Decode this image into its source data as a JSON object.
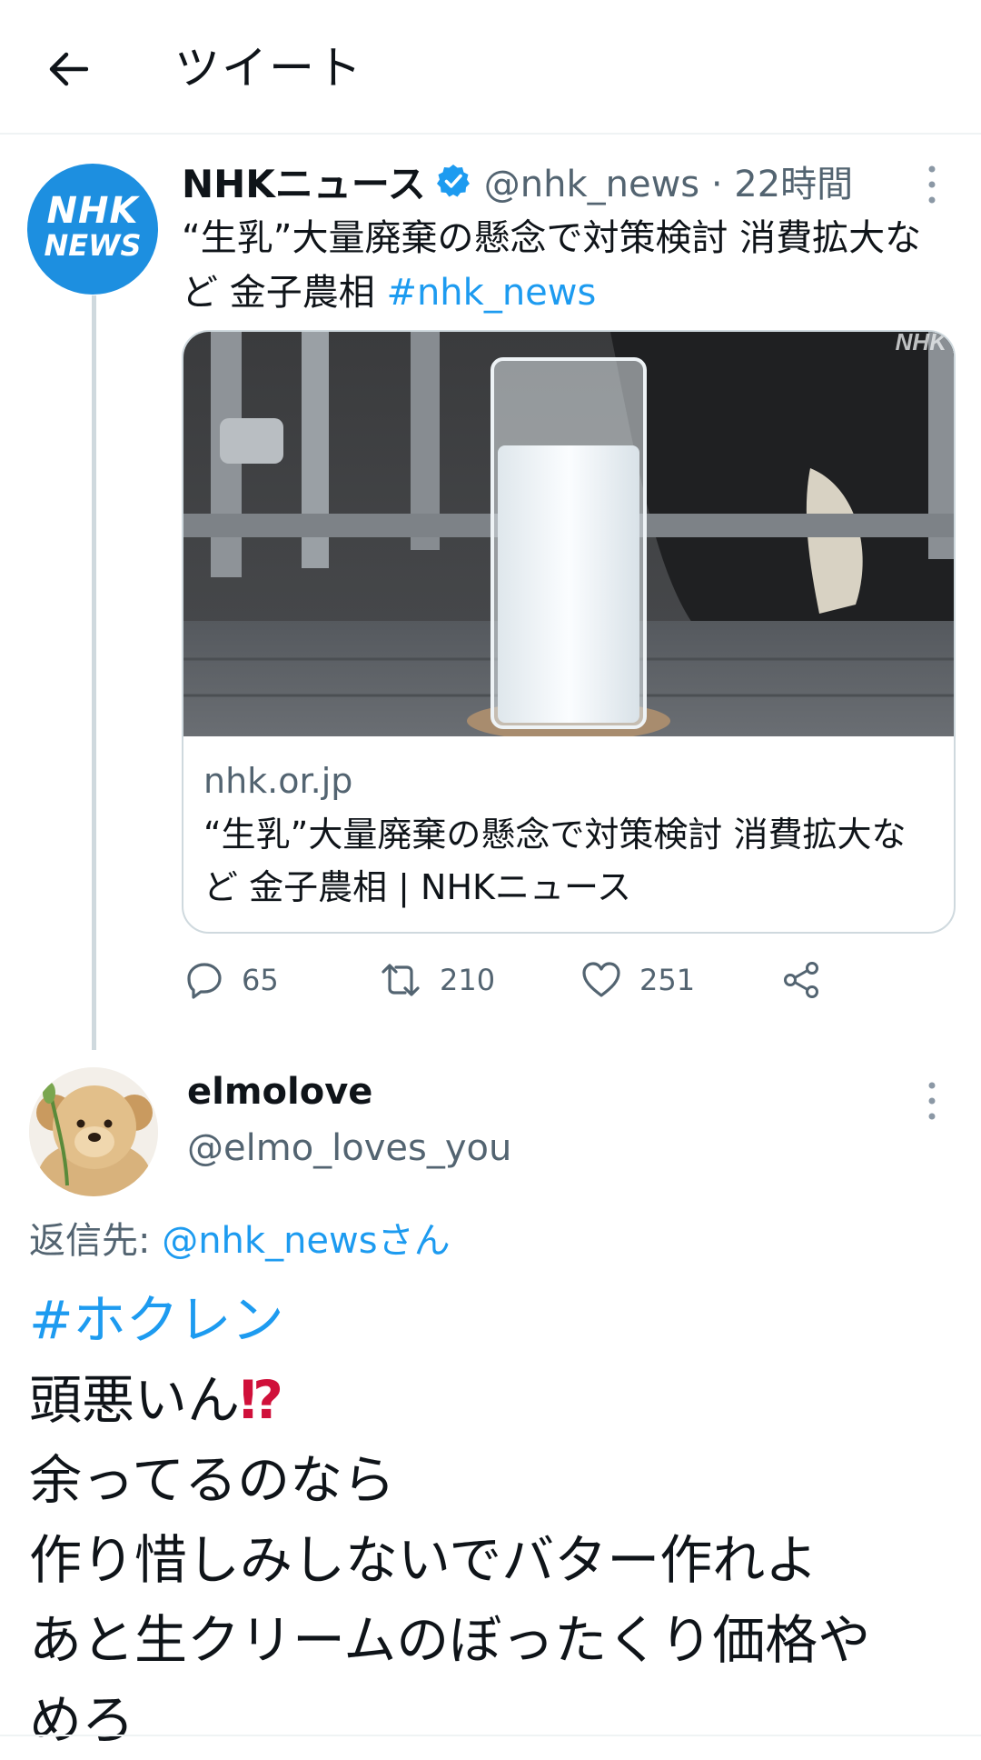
{
  "header": {
    "title": "ツイート"
  },
  "parent_tweet": {
    "avatar_text_top": "NHK",
    "avatar_text_bottom": "NEWS",
    "display_name": "NHKニュース",
    "handle_time": "@nhk_news · 22時間",
    "text": "“生乳”大量廃棄の懸念で対策検討 消費拡大など 金子農相",
    "hashtag": "#nhk_news",
    "card": {
      "image_watermark": "NHK",
      "domain": "nhk.or.jp",
      "title": "“生乳”大量廃棄の懸念で対策検討 消費拡大など 金子農相 | NHKニュース"
    },
    "stats": {
      "replies": "65",
      "retweets": "210",
      "likes": "251"
    }
  },
  "reply_tweet": {
    "display_name": "elmolove",
    "handle": "@elmo_loves_you",
    "reply_to_label": "返信先:",
    "reply_to_mention": "@nhk_newsさん",
    "hashtag": "#ホクレン",
    "line1": "頭悪いん",
    "line1_emoji": "⁉",
    "line2": "余ってるのなら",
    "line3": "作り惜しみしないでバター作れよ",
    "line4": "あと生クリームのぼったくり価格や",
    "line5": "めろ"
  },
  "colors": {
    "accent": "#1d9bf0",
    "secondary_text": "#536471",
    "nhk_blue": "#1d8fe0"
  },
  "icons": [
    "back-arrow-icon",
    "verified-icon",
    "more-icon",
    "reply-icon",
    "retweet-icon",
    "like-icon",
    "share-icon"
  ]
}
